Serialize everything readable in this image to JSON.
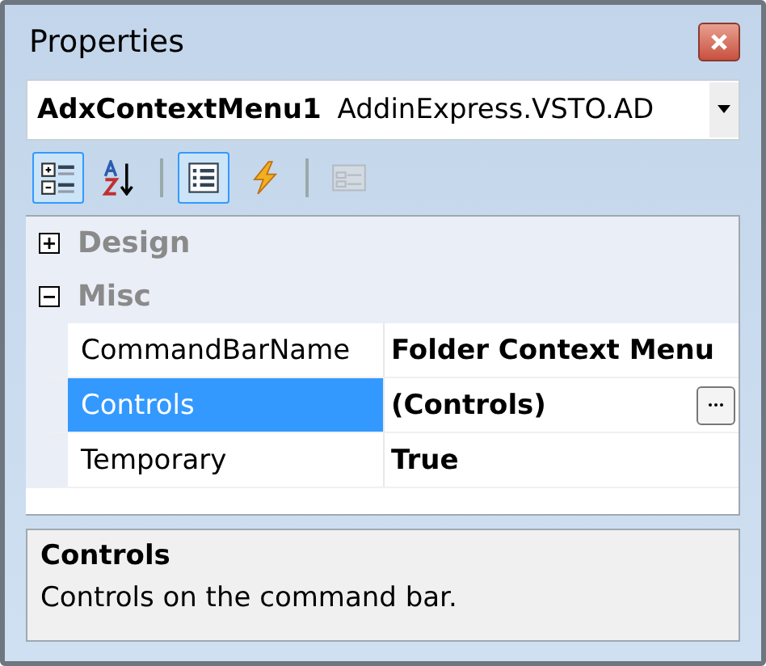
{
  "window": {
    "title": "Properties"
  },
  "object_selector": {
    "name": "AdxContextMenu1",
    "type": "AddinExpress.VSTO.AD"
  },
  "toolbar": [
    {
      "kind": "categorized",
      "selected": true,
      "disabled": false
    },
    {
      "kind": "alphabetical",
      "selected": false,
      "disabled": false
    },
    {
      "kind": "separator"
    },
    {
      "kind": "properties",
      "selected": true,
      "disabled": false
    },
    {
      "kind": "events",
      "selected": false,
      "disabled": false
    },
    {
      "kind": "separator"
    },
    {
      "kind": "property_pages",
      "selected": false,
      "disabled": true
    }
  ],
  "grid": {
    "categories": [
      {
        "label": "Design",
        "expanded": false
      },
      {
        "label": "Misc",
        "expanded": true,
        "properties": [
          {
            "name": "CommandBarName",
            "value": "Folder Context Menu",
            "selected": false,
            "has_button": false
          },
          {
            "name": "Controls",
            "value": "(Controls)",
            "selected": true,
            "has_button": true
          },
          {
            "name": "Temporary",
            "value": "True",
            "selected": false,
            "has_button": false
          }
        ]
      }
    ]
  },
  "description": {
    "title": "Controls",
    "text": "Controls on the command bar."
  }
}
